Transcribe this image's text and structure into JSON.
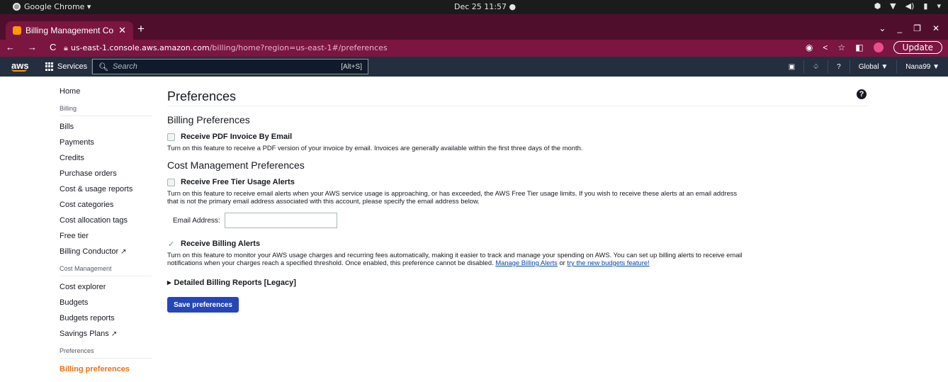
{
  "os": {
    "app_name": "Google Chrome ▾",
    "clock": "Dec 25 11:57  ●"
  },
  "browser": {
    "tab_title": "Billing Management Con",
    "url_host": "us-east-1.console.aws.amazon.com",
    "url_path": "/billing/home?region=us-east-1#/preferences",
    "update_label": "Update"
  },
  "aws_nav": {
    "logo": "aws",
    "services_label": "Services",
    "search_placeholder": "Search",
    "search_shortcut": "[Alt+S]",
    "region": "Global ▼",
    "account": "Nana99 ▼"
  },
  "sidebar": {
    "home": "Home",
    "section_billing": "Billing",
    "bills": "Bills",
    "payments": "Payments",
    "credits": "Credits",
    "purchase_orders": "Purchase orders",
    "cost_usage_reports": "Cost & usage reports",
    "cost_categories": "Cost categories",
    "cost_allocation_tags": "Cost allocation tags",
    "free_tier": "Free tier",
    "billing_conductor": "Billing Conductor",
    "section_cost_management": "Cost Management",
    "cost_explorer": "Cost explorer",
    "budgets": "Budgets",
    "budgets_reports": "Budgets reports",
    "savings_plans": "Savings Plans",
    "section_preferences": "Preferences",
    "billing_preferences": "Billing preferences"
  },
  "main": {
    "page_title": "Preferences",
    "billing_prefs_heading": "Billing Preferences",
    "pdf_label": "Receive PDF Invoice By Email",
    "pdf_desc": "Turn on this feature to receive a PDF version of your invoice by email. Invoices are generally available within the first three days of the month.",
    "cost_prefs_heading": "Cost Management Preferences",
    "free_tier_label": "Receive Free Tier Usage Alerts",
    "free_tier_desc": "Turn on this feature to receive email alerts when your AWS service usage is approaching, or has exceeded, the AWS Free Tier usage limits. If you wish to receive these alerts at an email address that is not the primary email address associated with this account, please specify the email address below.",
    "email_label": "Email Address:",
    "email_value": "",
    "billing_alerts_label": "Receive Billing Alerts",
    "billing_alerts_desc": "Turn on this feature to monitor your AWS usage charges and recurring fees automatically, making it easier to track and manage your spending on AWS. You can set up billing alerts to receive email notifications when your charges reach a specified threshold. Once enabled, this preference cannot be disabled.",
    "manage_alerts_link": "Manage Billing Alerts",
    "or_text": "or",
    "budgets_link": "try the new budgets feature!",
    "legacy_label": "Detailed Billing Reports [Legacy]",
    "save_label": "Save preferences"
  }
}
